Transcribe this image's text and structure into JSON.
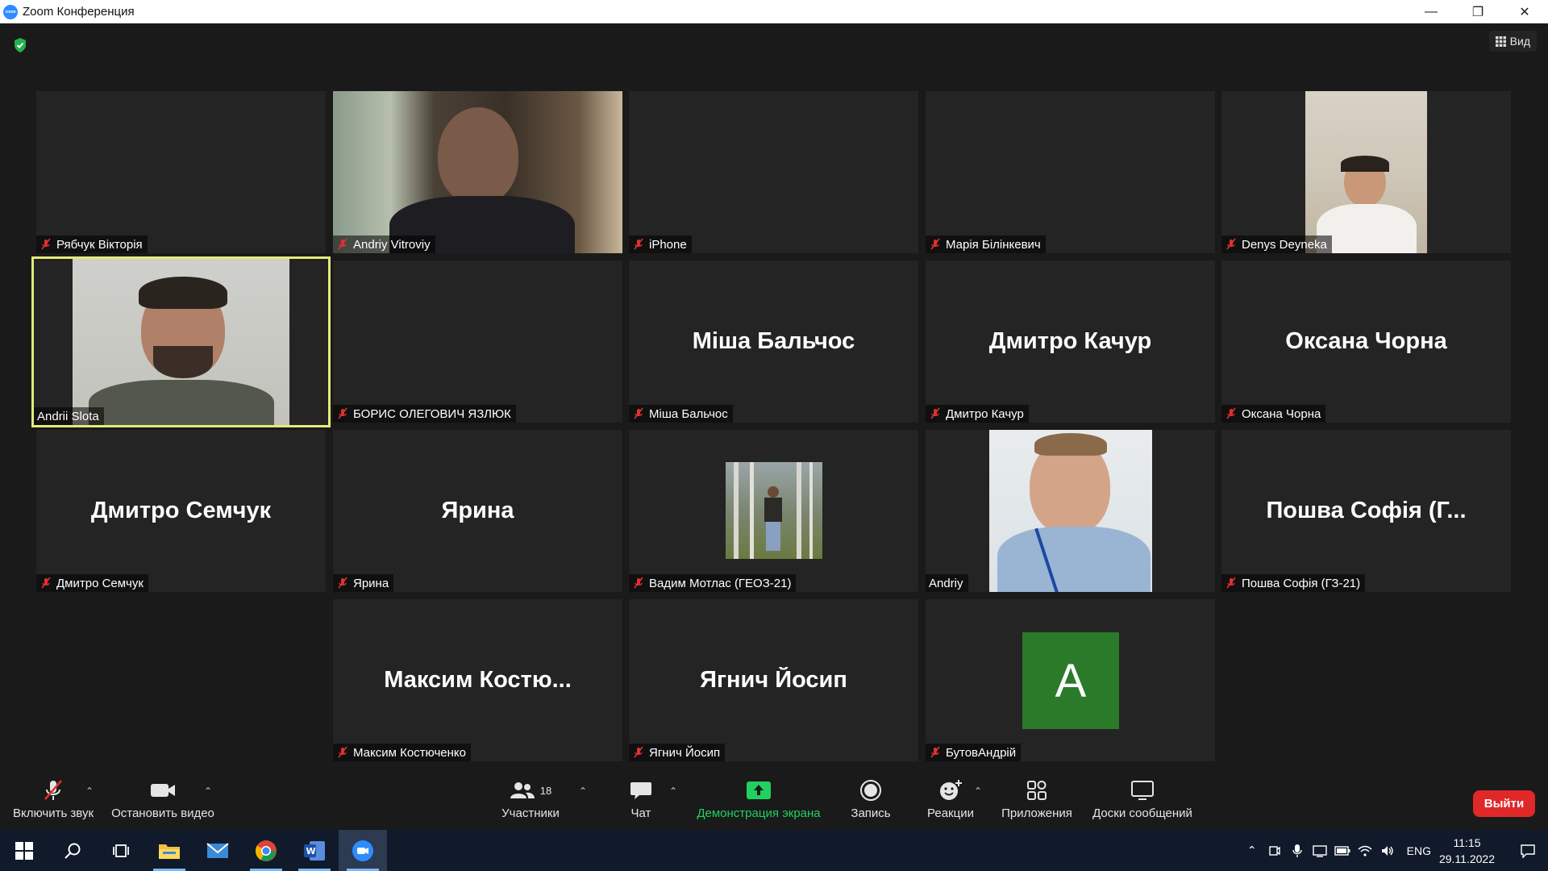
{
  "window": {
    "title": "Zoom Конференция",
    "logo_text": "zoom"
  },
  "header": {
    "view_label": "Вид"
  },
  "tiles": [
    {
      "name": "Рябчук Вікторія",
      "muted": true
    },
    {
      "name": "Andriy Vitroviy",
      "muted": true
    },
    {
      "name": "iPhone",
      "muted": true
    },
    {
      "name": "Марія Білінкевич",
      "muted": true
    },
    {
      "name": "Denys Deyneka",
      "muted": true
    },
    {
      "name": "Andrii Slota",
      "muted": false,
      "active_speaker": true
    },
    {
      "name": "БОРИС ОЛЕГОВИЧ ЯЗЛЮК",
      "muted": true
    },
    {
      "name": "Міша Бальчос",
      "display": "Міша Бальчос",
      "muted": true
    },
    {
      "name": "Дмитро Качур",
      "display": "Дмитро Качур",
      "muted": true
    },
    {
      "name": "Оксана Чорна",
      "display": "Оксана Чорна",
      "muted": true
    },
    {
      "name": "Дмитро Семчук",
      "display": "Дмитро Семчук",
      "muted": true
    },
    {
      "name": "Ярина",
      "display": "Ярина",
      "muted": true
    },
    {
      "name": "Вадим Мотлас (ГЕОЗ-21)",
      "muted": true
    },
    {
      "name": "Andriy",
      "muted": false
    },
    {
      "name": "Пошва Софія (ГЗ-21)",
      "display": "Пошва  Софія  (Г...",
      "muted": true
    },
    {
      "name": "Максим Костюченко",
      "display": "Максим  Костю...",
      "muted": true
    },
    {
      "name": "Ягнич Йосип",
      "display": "Ягнич Йосип",
      "muted": true
    },
    {
      "name": "БутовАндрій",
      "avatar_letter": "A",
      "muted": true
    }
  ],
  "toolbar": {
    "unmute_label": "Включить звук",
    "stop_video_label": "Остановить видео",
    "participants_label": "Участники",
    "participants_count": "18",
    "chat_label": "Чат",
    "share_label": "Демонстрация экрана",
    "record_label": "Запись",
    "reactions_label": "Реакции",
    "apps_label": "Приложения",
    "whiteboards_label": "Доски сообщений",
    "leave_label": "Выйти"
  },
  "colors": {
    "accent_green": "#20d060",
    "active_speaker": "#e2ea7a",
    "leave_red": "#e02828",
    "avatar_green": "#2a7a2a",
    "mute_red": "#e03030"
  },
  "taskbar": {
    "language": "ENG",
    "time": "11:15",
    "date": "29.11.2022"
  }
}
